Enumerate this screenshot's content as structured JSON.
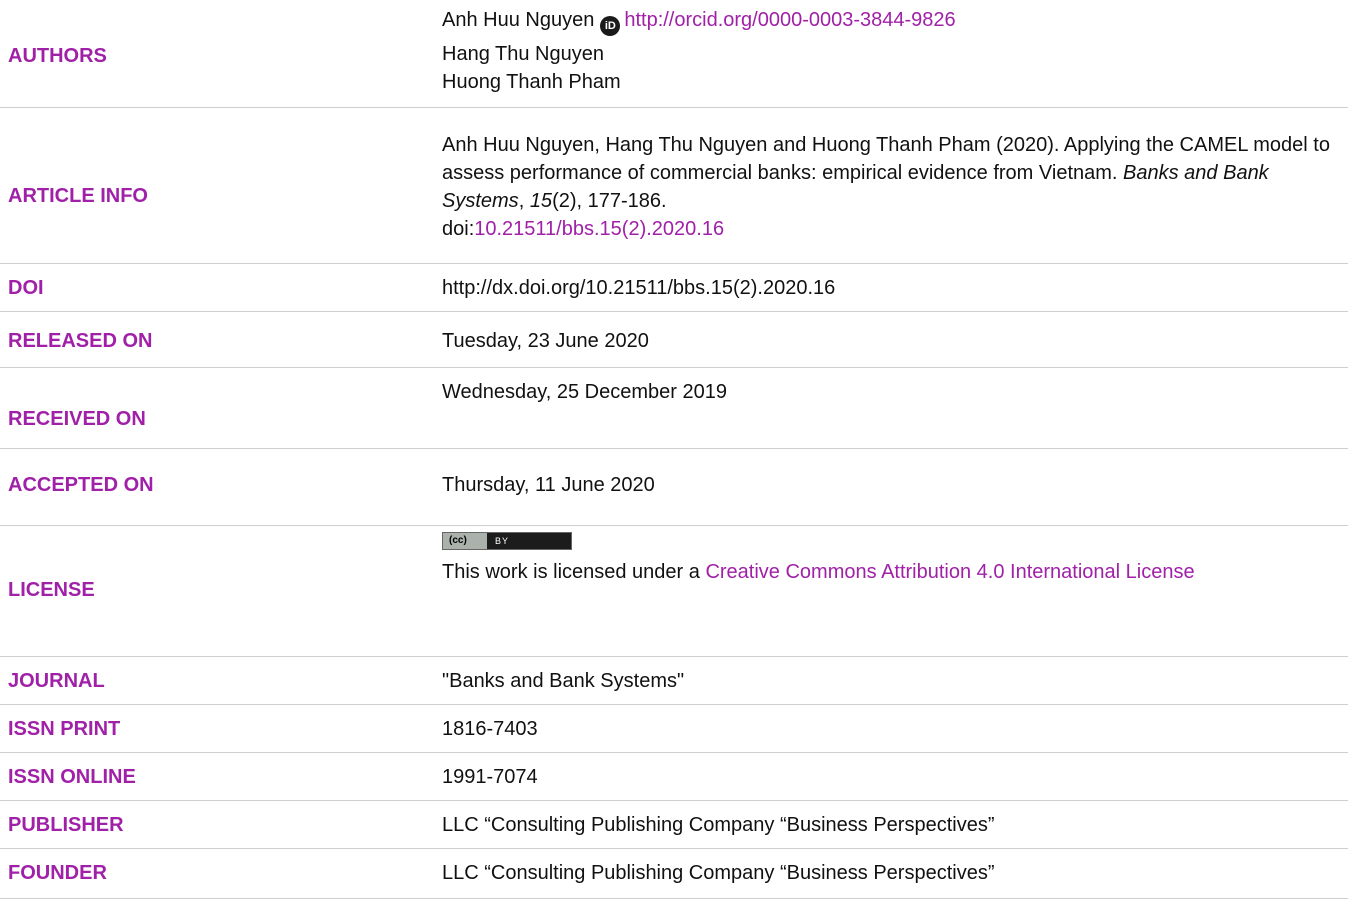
{
  "rows": {
    "authors": {
      "label": "AUTHORS",
      "author1_name": "Anh Huu Nguyen",
      "orcid_icon": "orcid-id-icon",
      "author1_orcid": "http://orcid.org/0000-0003-3844-9826",
      "author2": "Hang Thu Nguyen",
      "author3": "Huong Thanh Pham"
    },
    "article_info": {
      "label": "ARTICLE INFO",
      "citation_pre": "Anh Huu Nguyen, Hang Thu Nguyen and Huong Thanh Pham (2020). Applying the CAMEL model to assess performance of commercial banks: empirical evidence from Vietnam.",
      "journal_italic": "Banks and Bank Systems",
      "comma": ",",
      "volume_italic": "15",
      "issue_pages": "(2), 177-186.",
      "doi_prefix": "doi:",
      "doi_link": "10.21511/bbs.15(2).2020.16"
    },
    "doi": {
      "label": "DOI",
      "value": "http://dx.doi.org/10.21511/bbs.15(2).2020.16"
    },
    "released": {
      "label": "RELEASED ON",
      "value": "Tuesday, 23 June 2020"
    },
    "received": {
      "label": "RECEIVED ON",
      "value": "Wednesday, 25 December 2019"
    },
    "accepted": {
      "label": "ACCEPTED ON",
      "value": "Thursday, 11 June 2020"
    },
    "license": {
      "label": "LICENSE",
      "badge_cc": "(cc)",
      "badge_by": "BY",
      "text_pre": "This work is licensed under a ",
      "link": "Creative Commons Attribution 4.0 International License"
    },
    "journal": {
      "label": "JOURNAL",
      "value": "\"Banks and Bank Systems\""
    },
    "issn_print": {
      "label": "ISSN PRINT",
      "value": "1816-7403"
    },
    "issn_online": {
      "label": "ISSN ONLINE",
      "value": "1991-7074"
    },
    "publisher": {
      "label": "PUBLISHER",
      "value": "LLC “Consulting Publishing Company “Business Perspectives”"
    },
    "founder": {
      "label": "FOUNDER",
      "value": "LLC “Consulting Publishing Company “Business Perspectives”"
    }
  },
  "colors": {
    "label": "#a020a8",
    "link": "#a020a8",
    "text": "#111111",
    "rule": "#cfcfcf"
  }
}
